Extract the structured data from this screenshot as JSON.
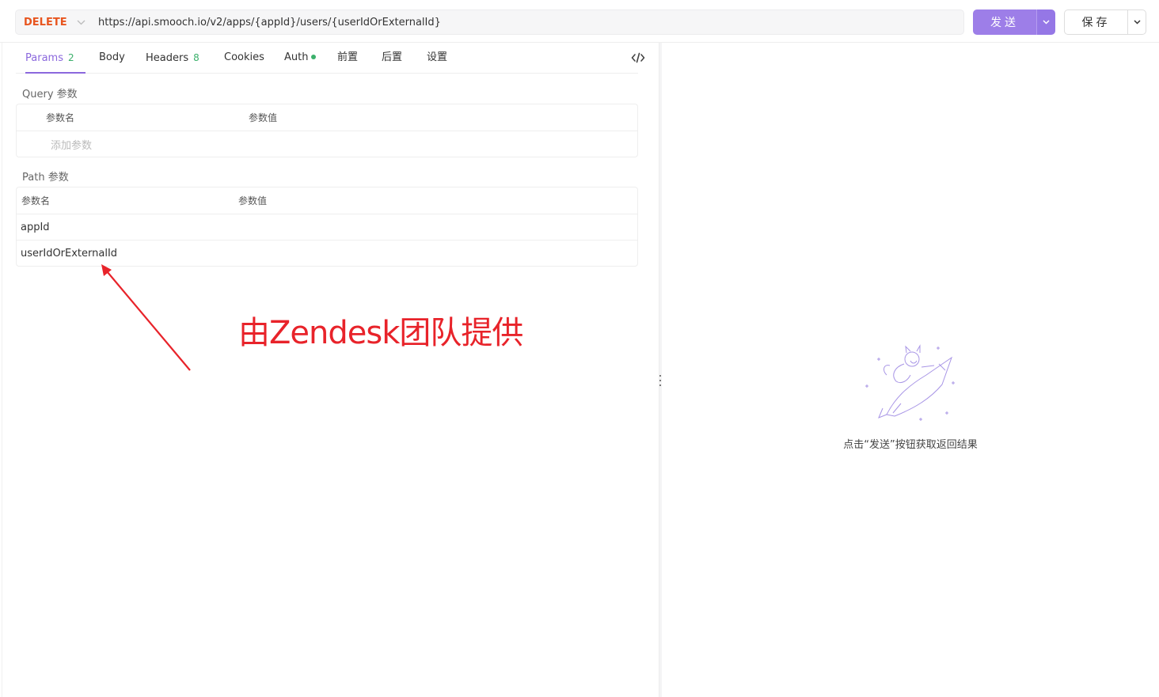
{
  "request": {
    "method": "DELETE",
    "url": "https://api.smooch.io/v2/apps/{appId}/users/{userIdOrExternalId}",
    "send_label": "发送",
    "save_label": "保存"
  },
  "tabs": [
    {
      "label": "Params",
      "count": "2"
    },
    {
      "label": "Body"
    },
    {
      "label": "Headers",
      "count": "8"
    },
    {
      "label": "Cookies"
    },
    {
      "label": "Auth"
    },
    {
      "label": "前置"
    },
    {
      "label": "后置"
    },
    {
      "label": "设置"
    }
  ],
  "query": {
    "title": "Query 参数",
    "col_name": "参数名",
    "col_value": "参数值",
    "add_placeholder": "添加参数"
  },
  "path": {
    "title": "Path 参数",
    "col_name": "参数名",
    "col_value": "参数值",
    "rows": [
      {
        "name": "appId"
      },
      {
        "name": "userIdOrExternalId"
      }
    ]
  },
  "annotation": {
    "text": "由Zendesk团队提供",
    "color": "#e8232a"
  },
  "response": {
    "empty_text": "点击“发送”按钮获取返回结果"
  },
  "colors": {
    "accent": "#9d7ee8",
    "method": "#e8551f",
    "count": "#3bb06b"
  }
}
